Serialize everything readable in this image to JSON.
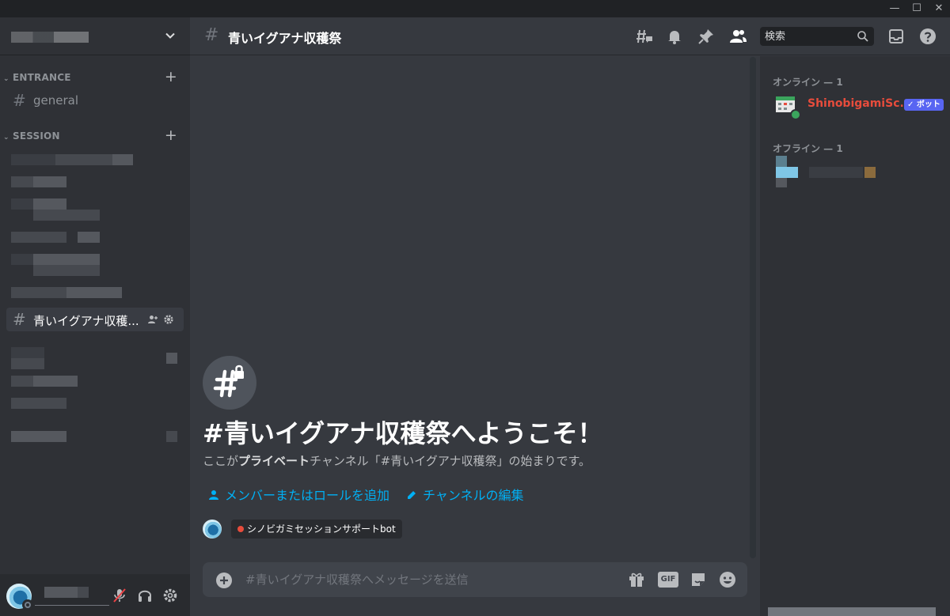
{
  "window": {
    "minimize": "—",
    "maximize": "☐",
    "close": "✕"
  },
  "sidebar": {
    "categories": [
      {
        "name": "ENTRANCE",
        "add": "+"
      },
      {
        "name": "SESSION",
        "add": "+"
      }
    ],
    "channels": [
      {
        "hash": "#",
        "name": "general"
      },
      {
        "hash": "#",
        "name": "青いイグアナ収穫..."
      }
    ]
  },
  "header": {
    "hash": "#",
    "title": "青いイグアナ収穫祭",
    "search_placeholder": "検索"
  },
  "welcome": {
    "title": "#青いイグアナ収穫祭へようこそ！",
    "desc_pre": "ここが",
    "desc_bold": "プライベート",
    "desc_post": "チャンネル「#青いイグアナ収穫祭」の始まりです。",
    "add_members": "メンバーまたはロールを追加",
    "edit_channel": "チャンネルの編集",
    "role_tag": "シノビガミセッションサポートbot"
  },
  "composer": {
    "placeholder": "#青いイグアナ収穫祭へメッセージを送信",
    "gif": "GIF"
  },
  "members": {
    "online_header": "オンライン — 1",
    "offline_header": "オフライン — 1",
    "online": [
      {
        "name": "ShinobigamiSc...",
        "badge": "✓ ボット"
      }
    ]
  },
  "colors": {
    "accent_link": "#00b0f4",
    "bot_badge": "#5865f2",
    "bot_name": "#e74c3c",
    "online": "#3ba55d"
  }
}
